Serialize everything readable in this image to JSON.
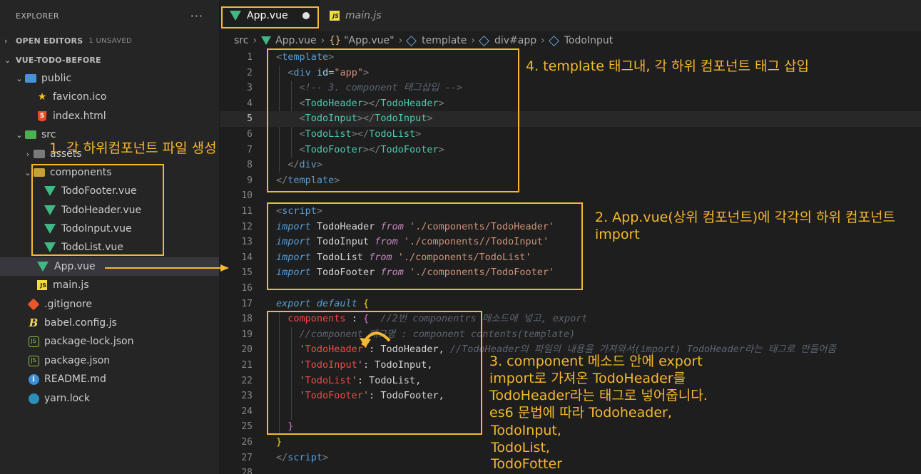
{
  "explorer": {
    "title": "EXPLORER",
    "more": "···",
    "open_editors": {
      "label": "OPEN EDITORS",
      "badge": "1 UNSAVED"
    },
    "project": {
      "label": "VUE-TODO-BEFORE"
    },
    "tree": [
      {
        "label": "public",
        "type": "folder",
        "icon": "folder-public-icon"
      },
      {
        "label": "favicon.ico",
        "type": "file",
        "icon": "star-icon"
      },
      {
        "label": "index.html",
        "type": "file",
        "icon": "html5-icon"
      },
      {
        "label": "src",
        "type": "folder",
        "icon": "folder-src-icon"
      },
      {
        "label": "assets",
        "type": "folder",
        "icon": "folder-icon"
      },
      {
        "label": "components",
        "type": "folder",
        "icon": "folder-components-icon"
      },
      {
        "label": "TodoFooter.vue",
        "type": "file",
        "icon": "vue-icon"
      },
      {
        "label": "TodoHeader.vue",
        "type": "file",
        "icon": "vue-icon"
      },
      {
        "label": "TodoInput.vue",
        "type": "file",
        "icon": "vue-icon"
      },
      {
        "label": "TodoList.vue",
        "type": "file",
        "icon": "vue-icon"
      },
      {
        "label": "App.vue",
        "type": "file",
        "icon": "vue-icon",
        "active": true
      },
      {
        "label": "main.js",
        "type": "file",
        "icon": "js-icon"
      },
      {
        "label": ".gitignore",
        "type": "file",
        "icon": "git-icon"
      },
      {
        "label": "babel.config.js",
        "type": "file",
        "icon": "babel-icon"
      },
      {
        "label": "package-lock.json",
        "type": "file",
        "icon": "nodejs-icon"
      },
      {
        "label": "package.json",
        "type": "file",
        "icon": "nodejs-icon"
      },
      {
        "label": "README.md",
        "type": "file",
        "icon": "info-icon"
      },
      {
        "label": "yarn.lock",
        "type": "file",
        "icon": "yarn-icon"
      }
    ]
  },
  "tabs": [
    {
      "label": "App.vue",
      "active": true,
      "unsaved": true
    },
    {
      "label": "main.js",
      "js_badge": "JS"
    }
  ],
  "breadcrumb": [
    "src",
    "App.vue",
    "{}",
    "\"App.vue\"",
    "template",
    "div#app",
    "TodoInput"
  ],
  "editor": {
    "line_numbers": [
      "1",
      "2",
      "3",
      "4",
      "5",
      "6",
      "7",
      "8",
      "9",
      "10",
      "11",
      "12",
      "13",
      "14",
      "15",
      "16",
      "17",
      "18",
      "19",
      "20",
      "21",
      "22",
      "23",
      "24",
      "25",
      "26",
      "27",
      "28"
    ]
  },
  "annotations": {
    "step1": "1. 각 하위컴포넌트 파일 생성",
    "step2_line1": "2. App.vue(상위 컴포넌트)에 각각의 하위 컴포넌트",
    "step2_line2": "import",
    "step3_lines": [
      "3. component 메소드 안에 export",
      "import로 가져온 TodoHeader를",
      "TodoHeader라는 태그로 넣어줍니다.",
      " es6 문법에 따라  Todoheader,",
      "TodoInput,",
      "TodoList,",
      "TodoFotter"
    ],
    "step4": "4.  template 태그내, 각 하위 컴포넌트 태그 삽입"
  },
  "colors": {
    "accent": "#f5b82e",
    "vue": "#41b883",
    "editor_bg": "#1e1e1e",
    "sidebar_bg": "#252526"
  }
}
